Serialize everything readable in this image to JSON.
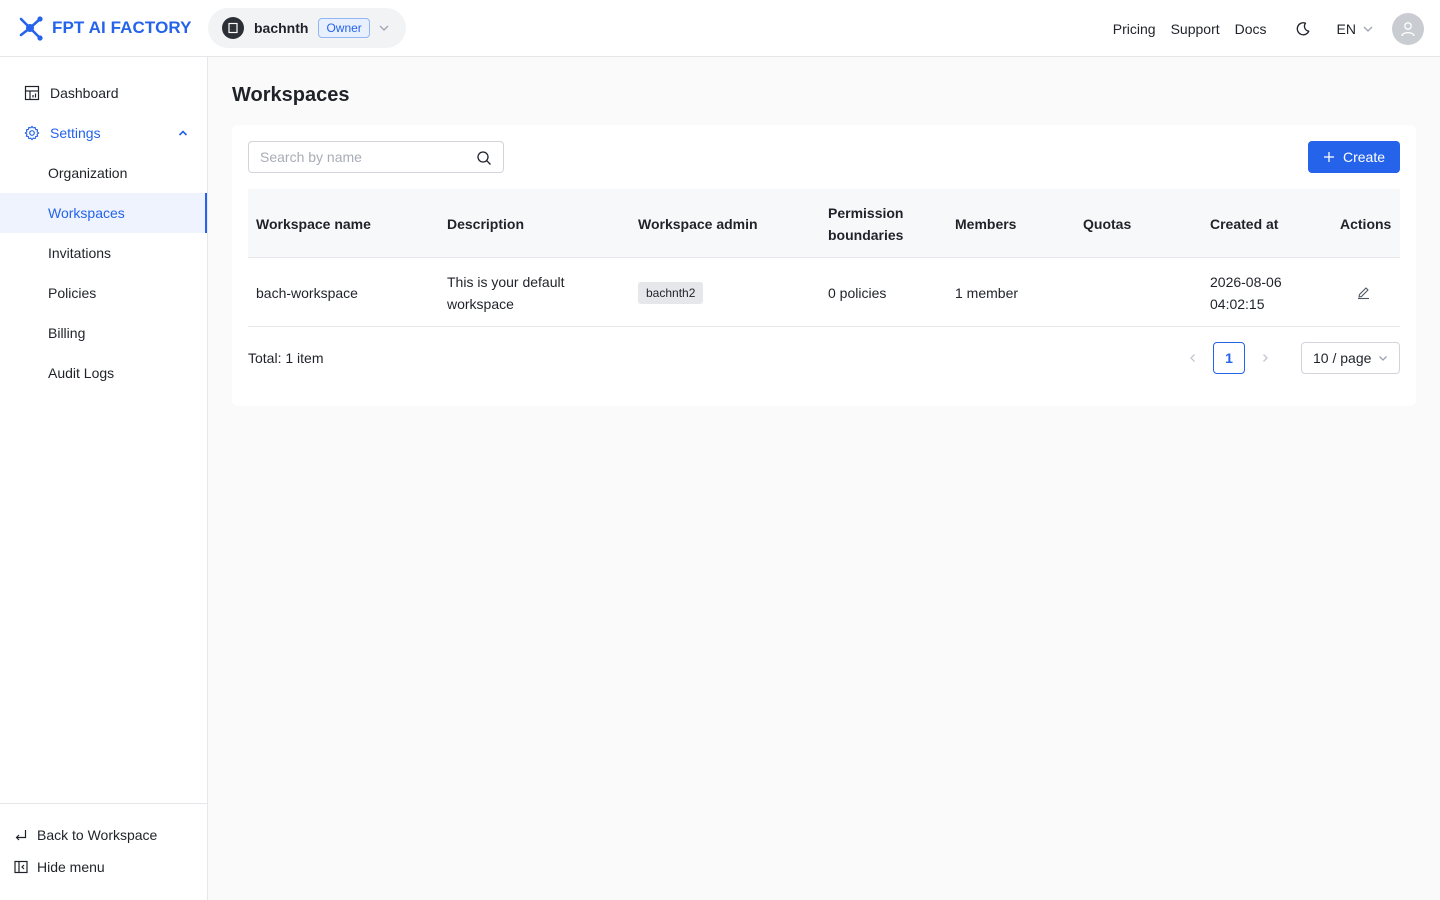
{
  "header": {
    "brand": "FPT AI FACTORY",
    "org_name": "bachnth",
    "org_role": "Owner",
    "links": [
      "Pricing",
      "Support",
      "Docs"
    ],
    "language": "EN"
  },
  "sidebar": {
    "items": [
      {
        "label": "Dashboard"
      },
      {
        "label": "Settings"
      },
      {
        "label": "Organization"
      },
      {
        "label": "Workspaces"
      },
      {
        "label": "Invitations"
      },
      {
        "label": "Policies"
      },
      {
        "label": "Billing"
      },
      {
        "label": "Audit Logs"
      }
    ],
    "footer": {
      "back": "Back to Workspace",
      "hide": "Hide menu"
    }
  },
  "main": {
    "title": "Workspaces",
    "search_placeholder": "Search by name",
    "create_label": "Create",
    "columns": [
      "Workspace name",
      "Description",
      "Workspace admin",
      "Permission boundaries",
      "Members",
      "Quotas",
      "Created at",
      "Actions"
    ],
    "rows": [
      {
        "name": "bach-workspace",
        "description": "This is your default workspace",
        "admin": "bachnth2",
        "permission_boundaries": "0 policies",
        "members": "1 member",
        "quotas": "",
        "created_at": "2026-08-06 04:02:15"
      }
    ],
    "total": "Total: 1 item",
    "current_page": "1",
    "page_size": "10 / page"
  },
  "colors": {
    "accent": "#2563eb",
    "active_bg": "#eef3fd"
  }
}
